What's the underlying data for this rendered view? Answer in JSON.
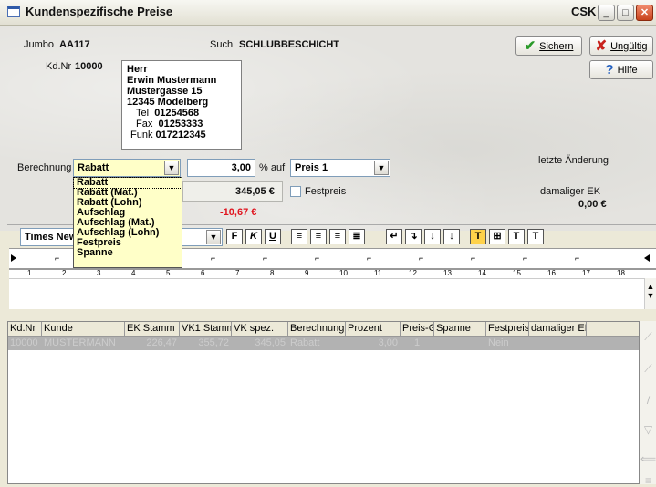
{
  "window": {
    "title": "Kundenspezifische Preise",
    "company": "CSK"
  },
  "header": {
    "jumbo_label": "Jumbo",
    "jumbo_value": "AA117",
    "such_label": "Such",
    "such_value": "SCHLUBBESCHICHT",
    "kdnr_label": "Kd.Nr",
    "kdnr_value": "10000"
  },
  "address": {
    "salutation": "Herr",
    "name": "Erwin Mustermann",
    "street": "Mustergasse 15",
    "city": "12345  Modelberg",
    "tel_label": "Tel",
    "tel_value": "01254568",
    "fax_label": "Fax",
    "fax_value": "01253333",
    "funk_label": "Funk",
    "funk_value": "017212345"
  },
  "buttons": {
    "save": "Sichern",
    "invalid": "Ungültig",
    "help": "Hilfe"
  },
  "calc": {
    "berechnung_label": "Berechnung",
    "berechnung_value": "Rabatt",
    "percent_value": "3,00",
    "percent_label": "% auf",
    "preis_value": "Preis 1",
    "price_result": "345,05 €",
    "festpreis_label": "Festpreis",
    "diff_value": "-10,67 €",
    "letzte_label": "letzte Änderung",
    "damaliger_label": "damaliger EK",
    "damaliger_value": "0,00 €"
  },
  "dropdown_options": [
    "Rabatt",
    "Rabatt (Mat.)",
    "Rabatt (Lohn)",
    "Aufschlag",
    "Aufschlag (Mat.)",
    "Aufschlag (Lohn)",
    "Festpreis",
    "Spanne"
  ],
  "toolbar": {
    "font": "Times New Roman",
    "bold": "F",
    "italic": "K",
    "underline": "U"
  },
  "ruler": {
    "ticks": [
      "1",
      "2",
      "3",
      "4",
      "5",
      "6",
      "7",
      "8",
      "9",
      "10",
      "11",
      "12",
      "13",
      "14",
      "15",
      "16",
      "17",
      "18"
    ]
  },
  "table": {
    "headers": [
      "Kd.Nr",
      "Kunde",
      "EK Stamm",
      "VK1 Stamm",
      "VK spez.",
      "Berechnung",
      "Prozent",
      "Preis-Gr",
      "Spanne",
      "Festpreis",
      "damaliger EK"
    ],
    "rows": [
      [
        "10000",
        "MUSTERMANN",
        "226,47",
        "355,72",
        "345,05",
        "Rabatt",
        "3,00",
        "1",
        "",
        "Nein",
        ""
      ]
    ]
  }
}
